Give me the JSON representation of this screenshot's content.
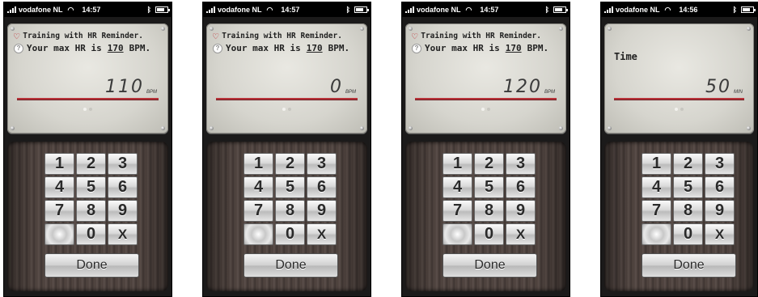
{
  "screens": [
    {
      "status": {
        "carrier": "vodafone NL",
        "time": "14:57"
      },
      "message": {
        "line1": "Training with HR Reminder.",
        "line2_prefix": "Your max HR is",
        "max_hr": "170",
        "line2_suffix": "BPM."
      },
      "reading": {
        "value": "110",
        "unit": "BPM"
      },
      "keys": [
        "1",
        "2",
        "3",
        "4",
        "5",
        "6",
        "7",
        "8",
        "9",
        "",
        "0",
        "X"
      ],
      "done_label": "Done",
      "page_indicator": {
        "current": 1,
        "total": 2
      }
    },
    {
      "status": {
        "carrier": "vodafone NL",
        "time": "14:57"
      },
      "message": {
        "line1": "Training with HR Reminder.",
        "line2_prefix": "Your max HR is",
        "max_hr": "170",
        "line2_suffix": "BPM."
      },
      "reading": {
        "value": "0",
        "unit": "BPM"
      },
      "keys": [
        "1",
        "2",
        "3",
        "4",
        "5",
        "6",
        "7",
        "8",
        "9",
        "",
        "0",
        "X"
      ],
      "done_label": "Done",
      "page_indicator": {
        "current": 1,
        "total": 2
      }
    },
    {
      "status": {
        "carrier": "vodafone NL",
        "time": "14:57"
      },
      "message": {
        "line1": "Training with HR Reminder.",
        "line2_prefix": "Your max HR is",
        "max_hr": "170",
        "line2_suffix": "BPM."
      },
      "reading": {
        "value": "120",
        "unit": "BPM"
      },
      "keys": [
        "1",
        "2",
        "3",
        "4",
        "5",
        "6",
        "7",
        "8",
        "9",
        "",
        "0",
        "X"
      ],
      "done_label": "Done",
      "page_indicator": {
        "current": 1,
        "total": 2
      }
    },
    {
      "status": {
        "carrier": "vodafone NL",
        "time": "14:56"
      },
      "label": "Time",
      "reading": {
        "value": "50",
        "unit": "MIN"
      },
      "keys": [
        "1",
        "2",
        "3",
        "4",
        "5",
        "6",
        "7",
        "8",
        "9",
        "",
        "0",
        "X"
      ],
      "done_label": "Done",
      "page_indicator": {
        "current": 1,
        "total": 2
      }
    }
  ],
  "colors": {
    "heart": "#c0202a",
    "redline": "#b8333a"
  }
}
